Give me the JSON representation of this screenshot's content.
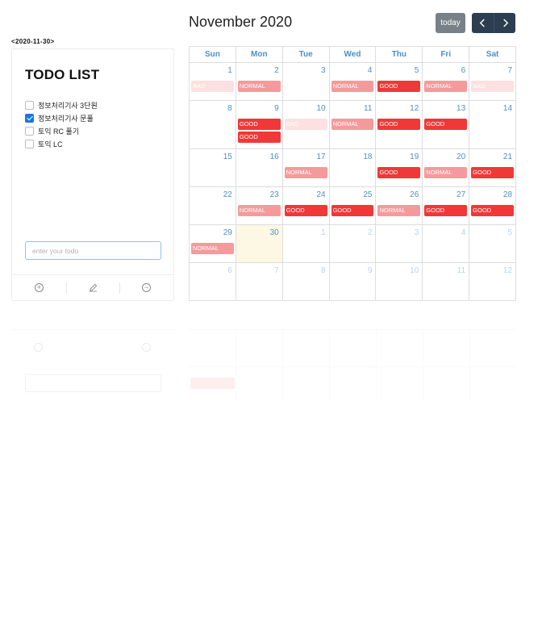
{
  "selected_date_label": "<2020-11-30>",
  "todo": {
    "title": "TODO LIST",
    "items": [
      {
        "text": "정보처리기사 3단원",
        "checked": false
      },
      {
        "text": "정보처리기사 문풀",
        "checked": true
      },
      {
        "text": "토익 RC 풀기",
        "checked": false
      },
      {
        "text": "토익 LC",
        "checked": false
      }
    ],
    "input": {
      "value": "",
      "placeholder": "enter your todo"
    },
    "toolbar": {
      "add_icon": "plus-circle-icon",
      "edit_icon": "pencil-icon",
      "delete_icon": "minus-circle-icon"
    }
  },
  "calendar": {
    "title": "November 2020",
    "today_label": "today",
    "prev_icon": "chevron-left-icon",
    "next_icon": "chevron-right-icon",
    "weekdays": [
      "Sun",
      "Mon",
      "Tue",
      "Wed",
      "Thu",
      "Fri",
      "Sat"
    ],
    "weeks": [
      [
        {
          "d": "1",
          "ev": [
            "BAD"
          ]
        },
        {
          "d": "2",
          "ev": [
            "NORMAL"
          ]
        },
        {
          "d": "3",
          "ev": []
        },
        {
          "d": "4",
          "ev": [
            "NORMAL"
          ]
        },
        {
          "d": "5",
          "ev": [
            "GOOD"
          ]
        },
        {
          "d": "6",
          "ev": [
            "NORMAL"
          ]
        },
        {
          "d": "7",
          "ev": [
            "BAD"
          ]
        }
      ],
      [
        {
          "d": "8",
          "ev": []
        },
        {
          "d": "9",
          "ev": [
            "GOOD",
            "GOOD"
          ]
        },
        {
          "d": "10",
          "ev": [
            "BAD"
          ]
        },
        {
          "d": "11",
          "ev": [
            "NORMAL"
          ]
        },
        {
          "d": "12",
          "ev": [
            "GOOD"
          ]
        },
        {
          "d": "13",
          "ev": [
            "GOOD"
          ]
        },
        {
          "d": "14",
          "ev": []
        }
      ],
      [
        {
          "d": "15",
          "ev": []
        },
        {
          "d": "16",
          "ev": []
        },
        {
          "d": "17",
          "ev": [
            "NORMAL"
          ]
        },
        {
          "d": "18",
          "ev": []
        },
        {
          "d": "19",
          "ev": [
            "GOOD"
          ]
        },
        {
          "d": "20",
          "ev": [
            "NORMAL"
          ]
        },
        {
          "d": "21",
          "ev": [
            "GOOD"
          ]
        }
      ],
      [
        {
          "d": "22",
          "ev": []
        },
        {
          "d": "23",
          "ev": [
            "NORMAL"
          ]
        },
        {
          "d": "24",
          "ev": [
            "GOOD"
          ]
        },
        {
          "d": "25",
          "ev": [
            "GOOD"
          ]
        },
        {
          "d": "26",
          "ev": [
            "NORMAL"
          ]
        },
        {
          "d": "27",
          "ev": [
            "GOOD"
          ]
        },
        {
          "d": "28",
          "ev": [
            "GOOD"
          ]
        }
      ],
      [
        {
          "d": "29",
          "ev": [
            "NORMAL"
          ]
        },
        {
          "d": "30",
          "ev": [],
          "today": true
        },
        {
          "d": "1",
          "ev": [],
          "other": true
        },
        {
          "d": "2",
          "ev": [],
          "other": true
        },
        {
          "d": "3",
          "ev": [],
          "other": true
        },
        {
          "d": "4",
          "ev": [],
          "other": true
        },
        {
          "d": "5",
          "ev": [],
          "other": true
        }
      ],
      [
        {
          "d": "6",
          "ev": [],
          "other": true
        },
        {
          "d": "7",
          "ev": [],
          "other": true
        },
        {
          "d": "8",
          "ev": [],
          "other": true
        },
        {
          "d": "9",
          "ev": [],
          "other": true
        },
        {
          "d": "10",
          "ev": [],
          "other": true
        },
        {
          "d": "11",
          "ev": [],
          "other": true
        },
        {
          "d": "12",
          "ev": [],
          "other": true
        }
      ]
    ],
    "event_colors": {
      "GOOD": "#f03838",
      "NORMAL": "#f59a9c",
      "BAD": "#fde0e1"
    },
    "today_bg": "#fcf8e3",
    "nav_bg": "#2c3e50",
    "today_btn_bg": "#7a8088",
    "accent": "#4a90c9"
  }
}
